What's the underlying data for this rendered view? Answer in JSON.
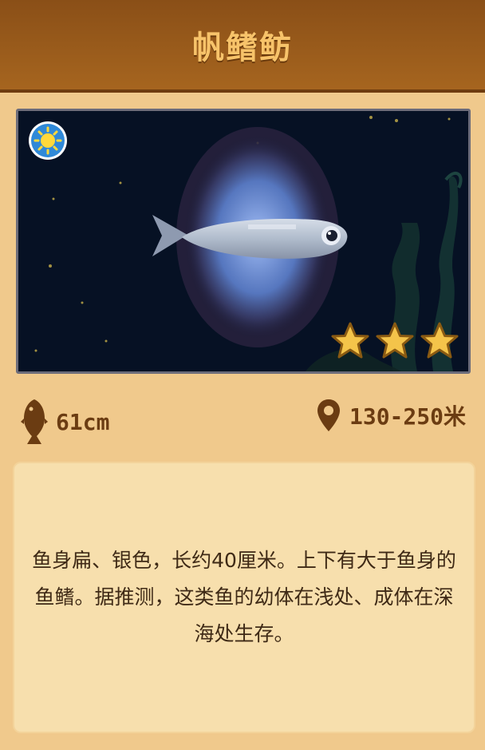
{
  "header": {
    "title": "帆鳍鲂"
  },
  "scene": {
    "daytime_icon": "sun-icon",
    "rating": 3,
    "rating_max": 3,
    "colors": {
      "water": "#061124",
      "fish": "#b9c4d6",
      "fin_glow": "#7fa4e8"
    }
  },
  "stats": {
    "size_icon": "fish-icon",
    "size_text": "61cm",
    "depth_icon": "location-pin-icon",
    "depth_text": "130-250米"
  },
  "description": {
    "text": "鱼身扁、银色，长约40厘米。上下有大于鱼身的鱼鳍。据推测，这类鱼的幼体在浅处、成体在深海处生存。"
  }
}
